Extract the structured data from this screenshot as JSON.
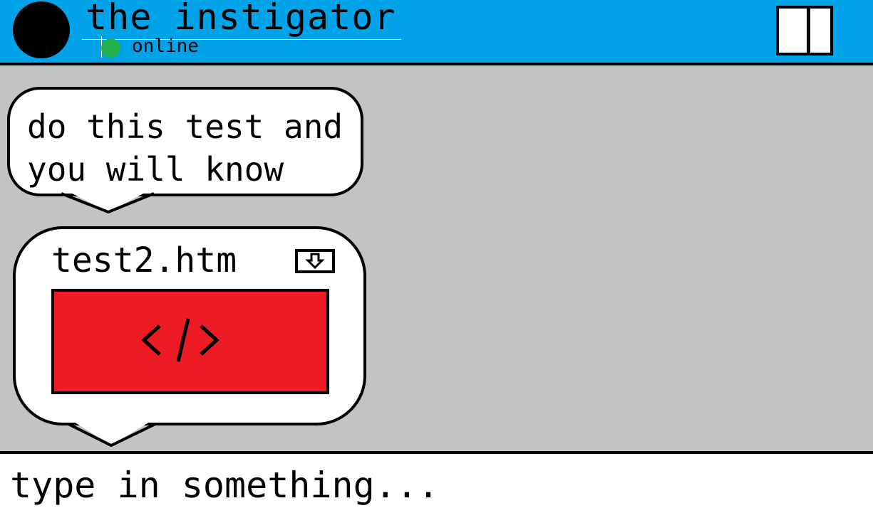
{
  "header": {
    "contact_name": "the instigator",
    "status": "online",
    "status_color": "#22b14c",
    "layout_icon": "split-view-icon"
  },
  "messages": [
    {
      "type": "text",
      "text": "do this test and\nyou will know"
    },
    {
      "type": "file",
      "file_name": "test2.htm",
      "download_icon": "download-icon",
      "preview_icon": "code-icon",
      "preview_color": "#ed1c24"
    }
  ],
  "composer": {
    "placeholder": "type in something..."
  },
  "colors": {
    "header_bg": "#00a2e8",
    "chat_bg": "#c3c3c3"
  }
}
